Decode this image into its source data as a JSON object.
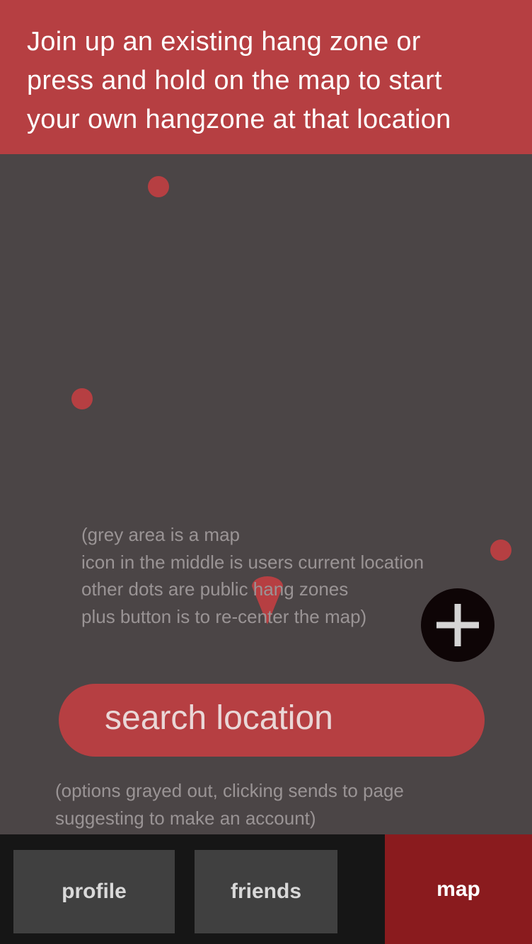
{
  "banner": {
    "lines": [
      "Join up an existing hang zone or",
      "press and hold on the map to start",
      "your own hangzone at that location"
    ]
  },
  "map": {
    "notes": [
      "(grey area is a map",
      "icon in the middle is users current location",
      "other dots are public hang zones",
      "plus button is to re-center the map)"
    ],
    "recenter_icon": "plus-icon"
  },
  "search": {
    "label": "search location"
  },
  "options_note": [
    "(options grayed out, clicking sends to page",
    "suggesting to make an account)"
  ],
  "nav": {
    "profile": "profile",
    "friends": "friends",
    "map": "map"
  },
  "colors": {
    "accent": "#b63f42",
    "map_background": "#4b4546",
    "nav_background": "#161616",
    "tab_inactive": "#404040",
    "tab_active": "#8a1b1e"
  }
}
